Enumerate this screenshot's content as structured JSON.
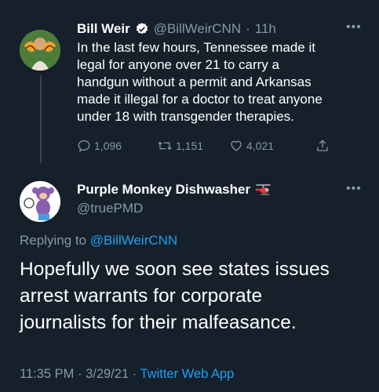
{
  "colors": {
    "background": "#15202b",
    "text": "#ffffff",
    "muted": "#8899a6",
    "accent": "#1da1f2"
  },
  "tweet1": {
    "name": "Bill Weir",
    "verified_icon": "verified-badge-icon",
    "handle": "@BillWeirCNN",
    "separator": "·",
    "time": "11h",
    "more_icon": "more-dots-icon",
    "lines": [
      "In the last few hours, Tennessee made it",
      "legal for anyone over 21 to carry a",
      "handgun without a permit and Arkansas",
      "made it illegal for a doctor to treat anyone",
      "under 18 with transgender therapies."
    ],
    "replies": "1,096",
    "retweets": "1,151",
    "likes": "4,021"
  },
  "tweet2": {
    "name": "Purple Monkey Dishwasher",
    "name_emoji_icon": "helicopter-icon",
    "handle": "@truePMD",
    "more_icon": "more-dots-icon",
    "replying_prefix": "Replying to",
    "replying_handle": "@BillWeirCNN",
    "lines": [
      "Hopefully we soon see states issues",
      "arrest warrants for corporate",
      "journalists for their malfeasance."
    ],
    "footer_time": "11:35 PM · 3/29/21 ·",
    "footer_app": "Twitter Web App"
  }
}
